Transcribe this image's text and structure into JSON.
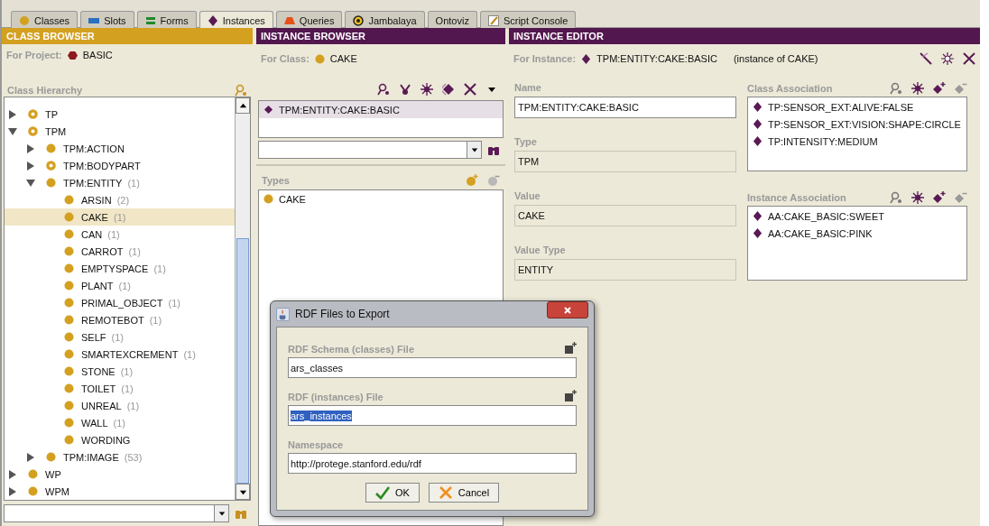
{
  "tabs": [
    {
      "label": "Classes",
      "kind": "class",
      "selected": false
    },
    {
      "label": "Slots",
      "kind": "slot",
      "selected": false
    },
    {
      "label": "Forms",
      "kind": "form",
      "selected": false
    },
    {
      "label": "Instances",
      "kind": "instance",
      "selected": true
    },
    {
      "label": "Queries",
      "kind": "query",
      "selected": false
    },
    {
      "label": "Jambalaya",
      "kind": "ring",
      "selected": false
    },
    {
      "label": "Ontoviz",
      "selected": false
    },
    {
      "label": "Script Console",
      "kind": "script",
      "selected": false
    }
  ],
  "class_browser": {
    "title": "CLASS BROWSER",
    "project_label": "For Project:",
    "project": "BASIC",
    "hierarchy_label": "Class Hierarchy",
    "tree": [
      {
        "name": "TP",
        "kind": "abstract",
        "expanded": false,
        "selected": false
      },
      {
        "name": "TPM",
        "kind": "abstract",
        "expanded": true,
        "selected": false,
        "children": [
          {
            "name": "TPM:ACTION",
            "kind": "concrete",
            "expanded": false,
            "selected": false
          },
          {
            "name": "TPM:BODYPART",
            "kind": "abstract",
            "expanded": false,
            "selected": false
          },
          {
            "name": "TPM:ENTITY",
            "count": "(1)",
            "kind": "concrete",
            "expanded": true,
            "selected": false,
            "children": [
              {
                "name": "ARSIN",
                "count": "(2)",
                "kind": "concrete",
                "selected": false
              },
              {
                "name": "CAKE",
                "count": "(1)",
                "kind": "concrete",
                "selected": true
              },
              {
                "name": "CAN",
                "count": "(1)",
                "kind": "concrete",
                "selected": false
              },
              {
                "name": "CARROT",
                "count": "(1)",
                "kind": "concrete",
                "selected": false
              },
              {
                "name": "EMPTYSPACE",
                "count": "(1)",
                "kind": "concrete",
                "selected": false
              },
              {
                "name": "PLANT",
                "count": "(1)",
                "kind": "concrete",
                "selected": false
              },
              {
                "name": "PRIMAL_OBJECT",
                "count": "(1)",
                "kind": "concrete",
                "selected": false
              },
              {
                "name": "REMOTEBOT",
                "count": "(1)",
                "kind": "concrete",
                "selected": false
              },
              {
                "name": "SELF",
                "count": "(1)",
                "kind": "concrete",
                "selected": false
              },
              {
                "name": "SMARTEXCREMENT",
                "count": "(1)",
                "kind": "concrete",
                "selected": false
              },
              {
                "name": "STONE",
                "count": "(1)",
                "kind": "concrete",
                "selected": false
              },
              {
                "name": "TOILET",
                "count": "(1)",
                "kind": "concrete",
                "selected": false
              },
              {
                "name": "UNREAL",
                "count": "(1)",
                "kind": "concrete",
                "selected": false
              },
              {
                "name": "WALL",
                "count": "(1)",
                "kind": "concrete",
                "selected": false
              },
              {
                "name": "WORDING",
                "kind": "concrete",
                "selected": false
              }
            ]
          },
          {
            "name": "TPM:IMAGE",
            "count": "(53)",
            "kind": "concrete",
            "expanded": false,
            "selected": false
          }
        ]
      },
      {
        "name": "WP",
        "kind": "concrete",
        "expanded": false,
        "selected": false
      },
      {
        "name": "WPM",
        "kind": "concrete",
        "expanded": false,
        "selected": false
      }
    ]
  },
  "instance_browser": {
    "title": "INSTANCE BROWSER",
    "class_label": "For Class:",
    "class": "CAKE",
    "instances": [
      {
        "name": "TPM:ENTITY:CAKE:BASIC",
        "selected": true
      }
    ],
    "types_label": "Types",
    "types": [
      {
        "name": "CAKE"
      }
    ]
  },
  "instance_editor": {
    "title": "INSTANCE EDITOR",
    "instance_label": "For Instance:",
    "instance": "TPM:ENTITY:CAKE:BASIC",
    "instance_of": "(instance of CAKE)",
    "fields": [
      {
        "label": "Name",
        "value": "TPM:ENTITY:CAKE:BASIC",
        "editable": true
      },
      {
        "label": "Type",
        "value": "TPM",
        "editable": false
      },
      {
        "label": "Value",
        "value": "CAKE",
        "editable": false
      },
      {
        "label": "Value Type",
        "value": "ENTITY",
        "editable": false
      }
    ],
    "associations": [
      {
        "label": "Class Association",
        "items": [
          "TP:SENSOR_EXT:ALIVE:FALSE",
          "TP:SENSOR_EXT:VISION:SHAPE:CIRCLE",
          "TP:INTENSITY:MEDIUM"
        ]
      },
      {
        "label": "Instance Association",
        "items": [
          "AA:CAKE_BASIC:SWEET",
          "AA:CAKE_BASIC:PINK"
        ]
      }
    ]
  },
  "dialog": {
    "title": "RDF Files to Export",
    "fields": [
      {
        "label": "RDF Schema (classes) File",
        "value": "ars_classes",
        "text_selected": false,
        "browse": true
      },
      {
        "label": "RDF (instances) File",
        "value": "ars_instances",
        "text_selected": true,
        "browse": true
      },
      {
        "label": "Namespace",
        "value": "http://protege.stanford.edu/rdf",
        "text_selected": false,
        "browse": false
      }
    ],
    "buttons": [
      {
        "label": "OK",
        "kind": "ok"
      },
      {
        "label": "Cancel",
        "kind": "cancel"
      }
    ]
  }
}
